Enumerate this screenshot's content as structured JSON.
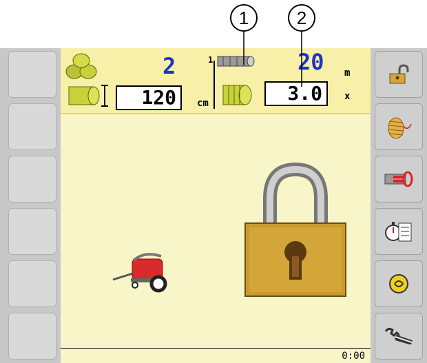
{
  "callouts": [
    "1",
    "2"
  ],
  "header": {
    "bale_count": "2",
    "bale_diameter": "120",
    "bale_diameter_unit": "cm",
    "net_layer_index": "1",
    "net_length": "20",
    "net_length_unit": "m",
    "net_wraps": "3.0",
    "net_wraps_unit": "x"
  },
  "status": {
    "clock": "0:00"
  },
  "icons": {
    "unlock": "unlock-icon",
    "twine": "twine-icon",
    "net_reset": "net-counter-reset-icon",
    "stopwatch_log": "stopwatch-log-icon",
    "lubrication": "lubrication-icon",
    "wrench": "wrench-icon",
    "padlock": "padlock-icon",
    "baler": "baler-icon"
  },
  "colors": {
    "screen_bg": "#f8f5c8",
    "header_bg": "#f8f0a8",
    "value_blue": "#1c34c4",
    "lock_gold": "#c99a2e"
  }
}
